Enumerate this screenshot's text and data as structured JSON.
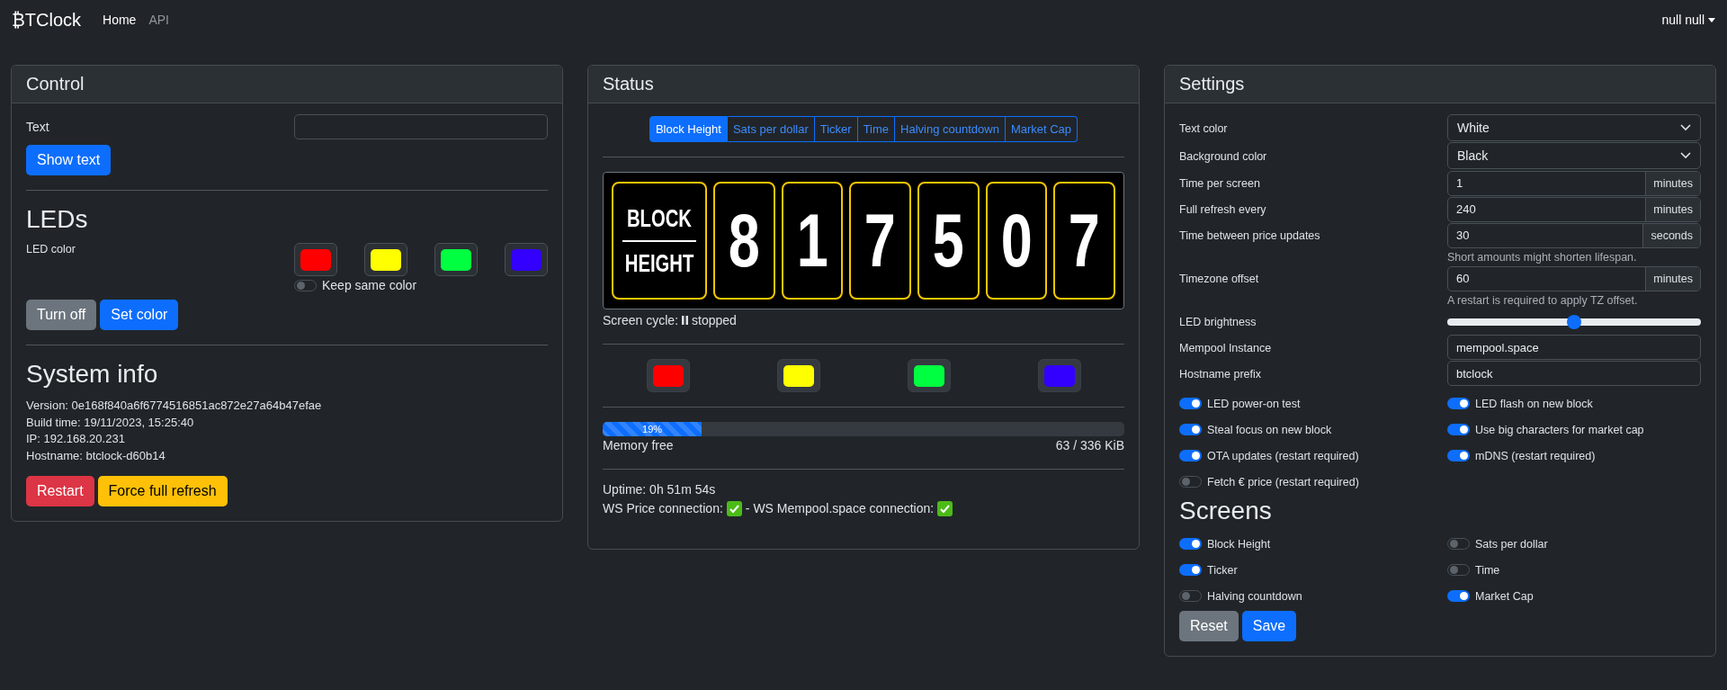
{
  "navbar": {
    "brand": "₿TClock",
    "links": [
      {
        "label": "Home",
        "selected": true
      },
      {
        "label": "API",
        "selected": false
      }
    ],
    "user": "null null"
  },
  "control": {
    "title": "Control",
    "text_label": "Text",
    "show_text_button": "Show text",
    "leds_heading": "LEDs",
    "led_color_label": "LED color",
    "led_swatches": [
      {
        "color": "#ff0000"
      },
      {
        "color": "#ffff00"
      },
      {
        "color": "#00ff40"
      },
      {
        "color": "#3300ff"
      }
    ],
    "keep_same_color": {
      "label": "Keep same color",
      "on": false
    },
    "led_buttons": [
      {
        "label": "Turn off",
        "kind": "secondary"
      },
      {
        "label": "Set color",
        "kind": "primary"
      }
    ],
    "system_info_heading": "System info",
    "info_lines": [
      "Version: 0e168f840a6f6774516851ac872e27a64b47efae",
      "Build time: 19/11/2023, 15:25:40",
      "IP: 192.168.20.231",
      "Hostname: btclock-d60b14"
    ],
    "system_buttons": [
      {
        "label": "Restart",
        "kind": "danger"
      },
      {
        "label": "Force full refresh",
        "kind": "warning"
      }
    ]
  },
  "status": {
    "title": "Status",
    "screen_tabs": [
      {
        "label": "Block Height",
        "selected": true
      },
      {
        "label": "Sats per dollar",
        "selected": false
      },
      {
        "label": "Ticker",
        "selected": false
      },
      {
        "label": "Time",
        "selected": false
      },
      {
        "label": "Halving countdown",
        "selected": false
      },
      {
        "label": "Market Cap",
        "selected": false
      }
    ],
    "display": {
      "label_top": "BLOCK",
      "label_bottom": "HEIGHT",
      "digits": [
        "8",
        "1",
        "7",
        "5",
        "0",
        "7"
      ]
    },
    "screen_cycle": {
      "label": "Screen cycle:",
      "state": "stopped",
      "running": false
    },
    "led_swatches": [
      {
        "color": "#ff0000"
      },
      {
        "color": "#ffff00"
      },
      {
        "color": "#00ff40"
      },
      {
        "color": "#3300ff"
      }
    ],
    "memory": {
      "level": 0.19,
      "percent": "19%",
      "label": "Memory free",
      "reading": "63 / 336 KiB"
    },
    "uptime": "Uptime: 0h 51m 54s",
    "connections": [
      {
        "label": "WS Price connection:",
        "ok": true
      },
      {
        "label": "- WS Mempool.space connection:",
        "ok": true
      }
    ]
  },
  "settings": {
    "title": "Settings",
    "fields": [
      {
        "kind": "select",
        "label": "Text color",
        "value": "White"
      },
      {
        "kind": "select",
        "label": "Background color",
        "value": "Black"
      },
      {
        "kind": "unit",
        "label": "Time per screen",
        "value": "1",
        "unit": "minutes"
      },
      {
        "kind": "unit",
        "label": "Full refresh every",
        "value": "240",
        "unit": "minutes"
      },
      {
        "kind": "unit",
        "label": "Time between price updates",
        "value": "30",
        "unit": "seconds",
        "hint": "Short amounts might shorten lifespan."
      },
      {
        "kind": "unit",
        "label": "Timezone offset",
        "value": "60",
        "unit": "minutes",
        "hint": "A restart is required to apply TZ offset."
      },
      {
        "kind": "range",
        "label": "LED brightness",
        "level": 0.5
      },
      {
        "kind": "text",
        "label": "Mempool Instance",
        "value": "mempool.space"
      },
      {
        "kind": "text",
        "label": "Hostname prefix",
        "value": "btclock"
      }
    ],
    "toggles": [
      {
        "label": "LED power-on test",
        "on": true
      },
      {
        "label": "LED flash on new block",
        "on": true
      },
      {
        "label": "Steal focus on new block",
        "on": true
      },
      {
        "label": "Use big characters for market cap",
        "on": true
      },
      {
        "label": "OTA updates (restart required)",
        "on": true
      },
      {
        "label": "mDNS (restart required)",
        "on": true
      },
      {
        "label": "Fetch € price (restart required)",
        "on": false
      }
    ],
    "screens_heading": "Screens",
    "screens": [
      {
        "label": "Block Height",
        "on": true
      },
      {
        "label": "Sats per dollar",
        "on": false
      },
      {
        "label": "Ticker",
        "on": true
      },
      {
        "label": "Time",
        "on": false
      },
      {
        "label": "Halving countdown",
        "on": false
      },
      {
        "label": "Market Cap",
        "on": true
      }
    ],
    "buttons": [
      {
        "label": "Reset",
        "kind": "secondary"
      },
      {
        "label": "Save",
        "kind": "primary"
      }
    ]
  }
}
